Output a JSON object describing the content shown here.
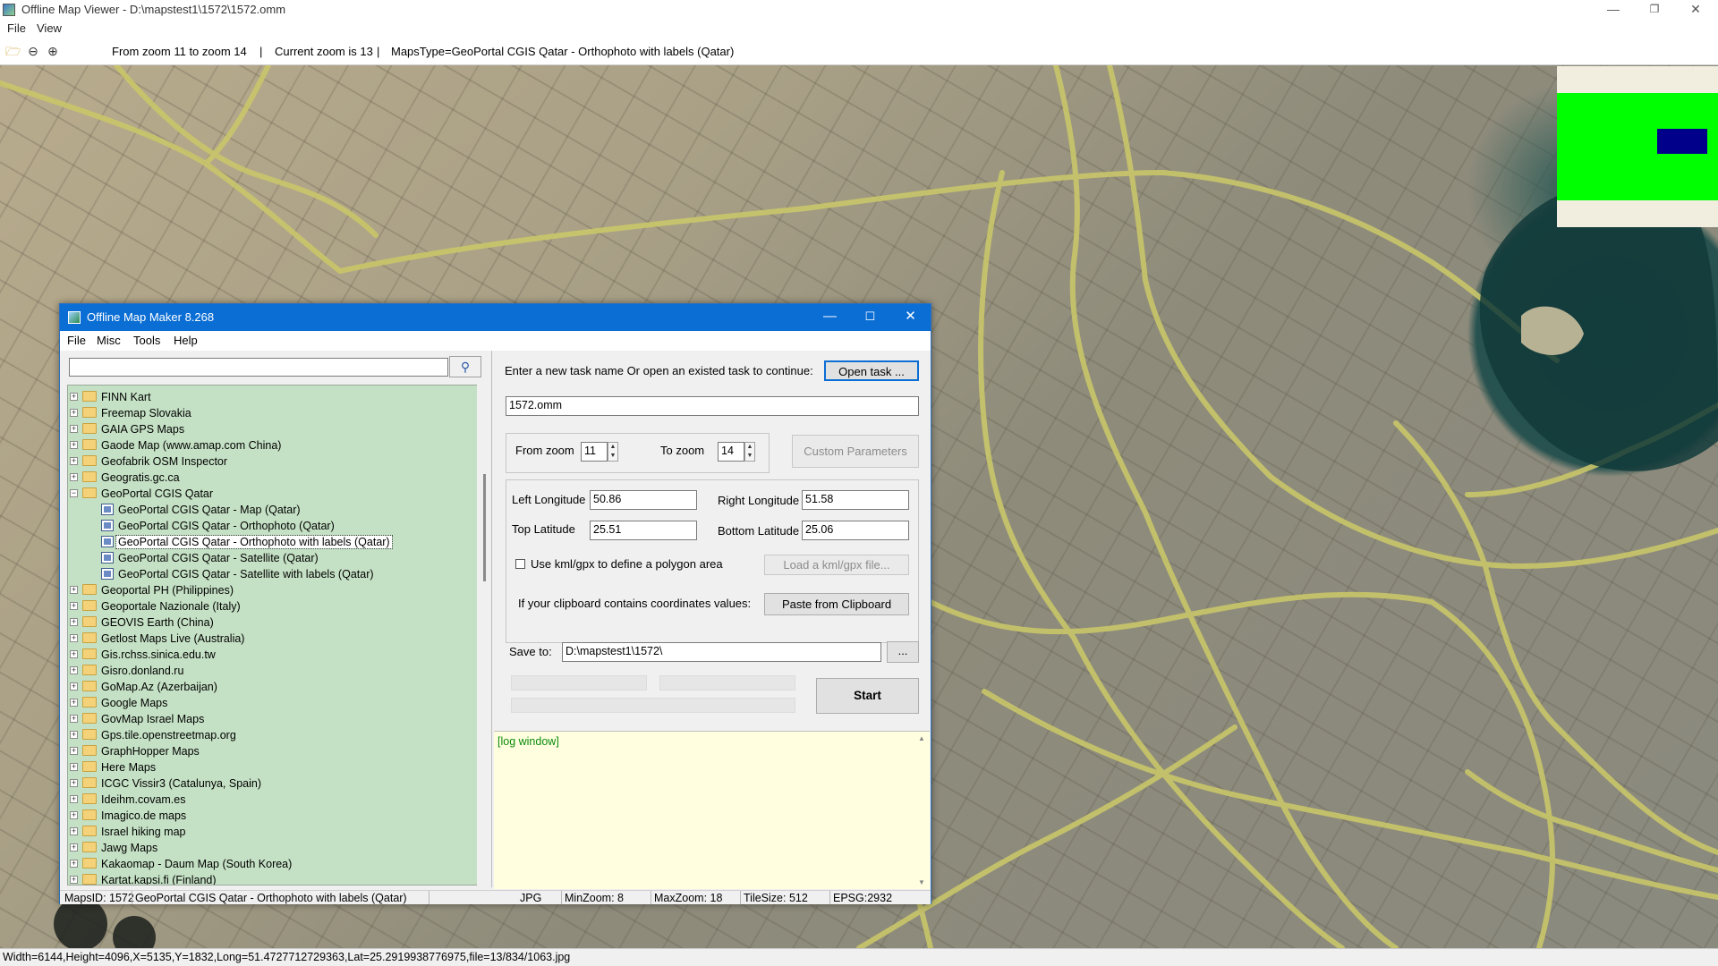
{
  "window": {
    "title": "Offline Map Viewer - D:\\mapstest1\\1572\\1572.omm"
  },
  "menu": {
    "file": "File",
    "view": "View"
  },
  "toolbar": {
    "zoom_range": "From zoom 11 to zoom 14",
    "current_zoom": "Current zoom is 13",
    "maps_type": "MapsType=GeoPortal CGIS Qatar - Orthophoto with labels (Qatar)",
    "sep": "|"
  },
  "statusbar": {
    "text": "Width=6144,Height=4096,X=5135,Y=1832,Long=51.4727712729363,Lat=25.2919938776975,file=13/834/1063.jpg"
  },
  "dialog": {
    "title": "Offline Map Maker 8.268",
    "menu": [
      "File",
      "Misc",
      "Tools",
      "Help"
    ],
    "search": {
      "value": ""
    },
    "tree": [
      {
        "label": "FINN Kart",
        "type": "folder"
      },
      {
        "label": "Freemap Slovakia",
        "type": "folder"
      },
      {
        "label": "GAIA GPS Maps",
        "type": "folder"
      },
      {
        "label": "Gaode Map (www.amap.com China)",
        "type": "folder"
      },
      {
        "label": "Geofabrik OSM Inspector",
        "type": "folder"
      },
      {
        "label": "Geogratis.gc.ca",
        "type": "folder"
      },
      {
        "label": "GeoPortal CGIS Qatar",
        "type": "folder-open"
      },
      {
        "label": "GeoPortal CGIS Qatar - Map (Qatar)",
        "type": "map"
      },
      {
        "label": "GeoPortal CGIS Qatar - Orthophoto (Qatar)",
        "type": "map"
      },
      {
        "label": "GeoPortal CGIS Qatar - Orthophoto with labels (Qatar)",
        "type": "map",
        "selected": true
      },
      {
        "label": "GeoPortal CGIS Qatar - Satellite (Qatar)",
        "type": "map"
      },
      {
        "label": "GeoPortal CGIS Qatar - Satellite with labels (Qatar)",
        "type": "map"
      },
      {
        "label": "Geoportal PH (Philippines)",
        "type": "folder"
      },
      {
        "label": "Geoportale Nazionale (Italy)",
        "type": "folder"
      },
      {
        "label": "GEOVIS Earth (China)",
        "type": "folder"
      },
      {
        "label": "Getlost Maps Live (Australia)",
        "type": "folder"
      },
      {
        "label": "Gis.rchss.sinica.edu.tw",
        "type": "folder"
      },
      {
        "label": "Gisro.donland.ru",
        "type": "folder"
      },
      {
        "label": "GoMap.Az (Azerbaijan)",
        "type": "folder"
      },
      {
        "label": "Google Maps",
        "type": "folder"
      },
      {
        "label": "GovMap Israel Maps",
        "type": "folder"
      },
      {
        "label": "Gps.tile.openstreetmap.org",
        "type": "folder"
      },
      {
        "label": "GraphHopper Maps",
        "type": "folder"
      },
      {
        "label": "Here Maps",
        "type": "folder"
      },
      {
        "label": "ICGC Vissir3 (Catalunya, Spain)",
        "type": "folder"
      },
      {
        "label": "Ideihm.covam.es",
        "type": "folder"
      },
      {
        "label": "Imagico.de maps",
        "type": "folder"
      },
      {
        "label": "Israel hiking map",
        "type": "folder"
      },
      {
        "label": "Jawg Maps",
        "type": "folder"
      },
      {
        "label": "Kakaomap - Daum Map (South Korea)",
        "type": "folder"
      },
      {
        "label": "Kartat.kapsi.fi (Finland)",
        "type": "folder"
      }
    ],
    "task": {
      "prompt": "Enter a new task name Or open an existed task to continue:",
      "open_button": "Open task ...",
      "name_value": "1572.omm"
    },
    "zoom": {
      "from_label": "From zoom",
      "from_value": "11",
      "to_label": "To zoom",
      "to_value": "14",
      "custom_button": "Custom Parameters"
    },
    "coords": {
      "left_lon_label": "Left Longitude",
      "left_lon_value": "50.86",
      "right_lon_label": "Right Longitude",
      "right_lon_value": "51.58",
      "top_lat_label": "Top Latitude",
      "top_lat_value": "25.51",
      "bottom_lat_label": "Bottom Latitude",
      "bottom_lat_value": "25.06",
      "kml_label": "Use kml/gpx to define a polygon area",
      "kml_checked": false,
      "kml_button": "Load a kml/gpx file...",
      "clipboard_label": "If your clipboard contains coordinates values:",
      "clipboard_button": "Paste from Clipboard"
    },
    "save": {
      "label": "Save to:",
      "value": "D:\\mapstest1\\1572\\",
      "browse": "..."
    },
    "start_button": "Start",
    "log": "[log window]",
    "status": {
      "maps_id": "MapsID: 1572",
      "maps_name": "GeoPortal CGIS Qatar - Orthophoto with labels (Qatar)",
      "format": "JPG",
      "min_zoom": "MinZoom: 8",
      "max_zoom": "MaxZoom: 18",
      "tile_size": "TileSize: 512",
      "epsg": "EPSG:2932"
    }
  },
  "icons": [
    "app-icon",
    "open-folder-icon",
    "zoom-out-icon",
    "zoom-in-icon",
    "search-icon",
    "minimize-icon",
    "maximize-icon",
    "close-icon"
  ],
  "colors": {
    "dialog_title": "#0b6ed4",
    "tree_bg": "#c5e1c5",
    "log_bg": "#ffffe0",
    "log_text": "#0a8a0a",
    "overview_green": "#00ff00",
    "overview_box": "#00008b"
  }
}
